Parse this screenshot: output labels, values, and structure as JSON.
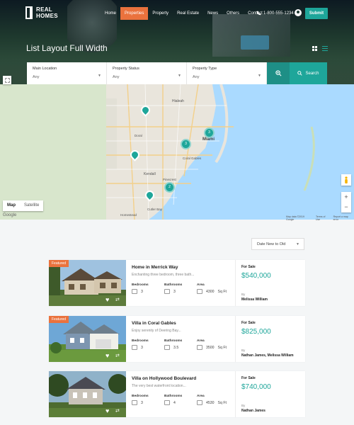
{
  "brand": {
    "name": "REAL HOMES"
  },
  "nav": {
    "items": [
      {
        "label": "Home",
        "active": false
      },
      {
        "label": "Properties",
        "active": true
      },
      {
        "label": "Property",
        "active": false
      },
      {
        "label": "Real Estate",
        "active": false
      },
      {
        "label": "News",
        "active": false
      },
      {
        "label": "Others",
        "active": false
      },
      {
        "label": "Contact",
        "active": false
      }
    ],
    "phone": "1-800-555-1234",
    "submit_label": "Submit"
  },
  "page_title": "List Layout Full Width",
  "search": {
    "fields": [
      {
        "label": "Main Location",
        "value": "Any"
      },
      {
        "label": "Property Status",
        "value": "Any"
      },
      {
        "label": "Property Type",
        "value": "Any"
      }
    ],
    "button_label": "Search"
  },
  "map": {
    "toggle": {
      "map": "Map",
      "satellite": "Satellite"
    },
    "logo": "Google",
    "attribution": [
      "Map data ©2019 Google",
      "Terms of Use",
      "Report a map error"
    ],
    "places": [
      "Hialeah",
      "Miami",
      "Kendall",
      "Coral Gables",
      "Pinecrest",
      "Doral",
      "Cutler Bay",
      "Homestead"
    ],
    "clusters": [
      "3",
      "3",
      "2"
    ]
  },
  "sort": {
    "label": "Date New to Old"
  },
  "listings": [
    {
      "featured": "Featured",
      "title": "Home in Merrick Way",
      "desc": "Enchanting three bedroom, three bath...",
      "bedrooms_label": "Bedrooms",
      "bedrooms": "3",
      "bathrooms_label": "Bathrooms",
      "bathrooms": "3",
      "area_label": "Area",
      "area": "4300",
      "area_unit": "Sq Ft",
      "status": "For Sale",
      "price": "$540,000",
      "by": "By",
      "agent": "Melissa William"
    },
    {
      "featured": "Featured",
      "title": "Villa in Coral Gables",
      "desc": "Enjoy serenity of Deering Bay...",
      "bedrooms_label": "Bedrooms",
      "bedrooms": "3",
      "bathrooms_label": "Bathrooms",
      "bathrooms": "3.5",
      "area_label": "Area",
      "area": "3500",
      "area_unit": "Sq Ft",
      "status": "For Sale",
      "price": "$825,000",
      "by": "By",
      "agent": "Nathan James, Melissa William"
    },
    {
      "featured": "",
      "title": "Villa on Hollywood Boulevard",
      "desc": "The very best waterfront location...",
      "bedrooms_label": "Bedrooms",
      "bedrooms": "3",
      "bathrooms_label": "Bathrooms",
      "bathrooms": "4",
      "area_label": "Area",
      "area": "4530",
      "area_unit": "Sq Ft",
      "status": "For Sale",
      "price": "$740,000",
      "by": "By",
      "agent": "Nathan James"
    }
  ],
  "colors": {
    "accent": "#1ea69a",
    "orange": "#ea723d"
  }
}
